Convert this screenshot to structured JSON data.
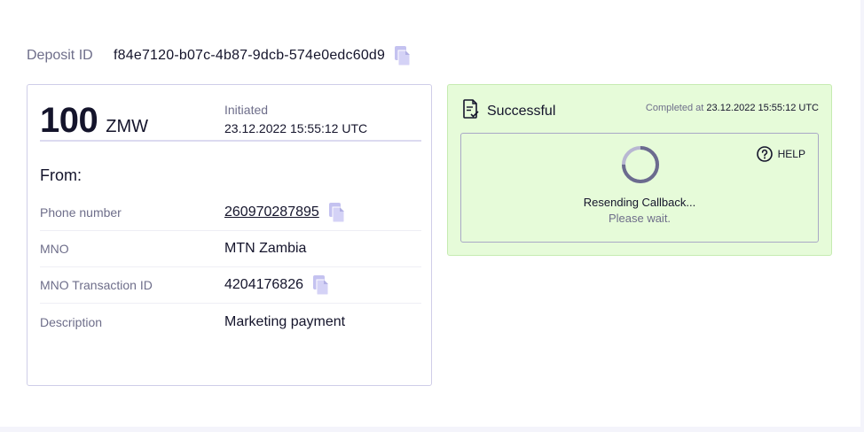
{
  "deposit": {
    "label": "Deposit ID",
    "id": "f84e7120-b07c-4b87-9dcb-574e0edc60d9"
  },
  "summary": {
    "amount": "100",
    "currency": "ZMW",
    "status_label": "Initiated",
    "status_time": "23.12.2022 15:55:12 UTC"
  },
  "from": {
    "label": "From:",
    "rows": [
      {
        "key": "Phone number",
        "value": "260970287895"
      },
      {
        "key": "MNO",
        "value": "MTN Zambia"
      },
      {
        "key": "MNO Transaction ID",
        "value": "4204176826"
      },
      {
        "key": "Description",
        "value": "Marketing payment"
      }
    ]
  },
  "result": {
    "title": "Successful",
    "completed_prefix": "Completed at",
    "completed_time": "23.12.2022 15:55:12 UTC",
    "help_label": "HELP",
    "resend_title": "Resending Callback...",
    "resend_subtitle": "Please wait.",
    "spinner_progress": 0.75
  },
  "icons": {
    "copy": "copy-icon",
    "document_check": "document-check-icon",
    "help": "help-circle-icon",
    "spinner": "loading-spinner-icon"
  },
  "colors": {
    "accent_copy": "#c4c2f0",
    "success_bg": "#e6fbd9",
    "success_border": "#c6ebb1",
    "spinner_track": "#b8b7d2",
    "spinner_arc": "#6b6b8e"
  }
}
